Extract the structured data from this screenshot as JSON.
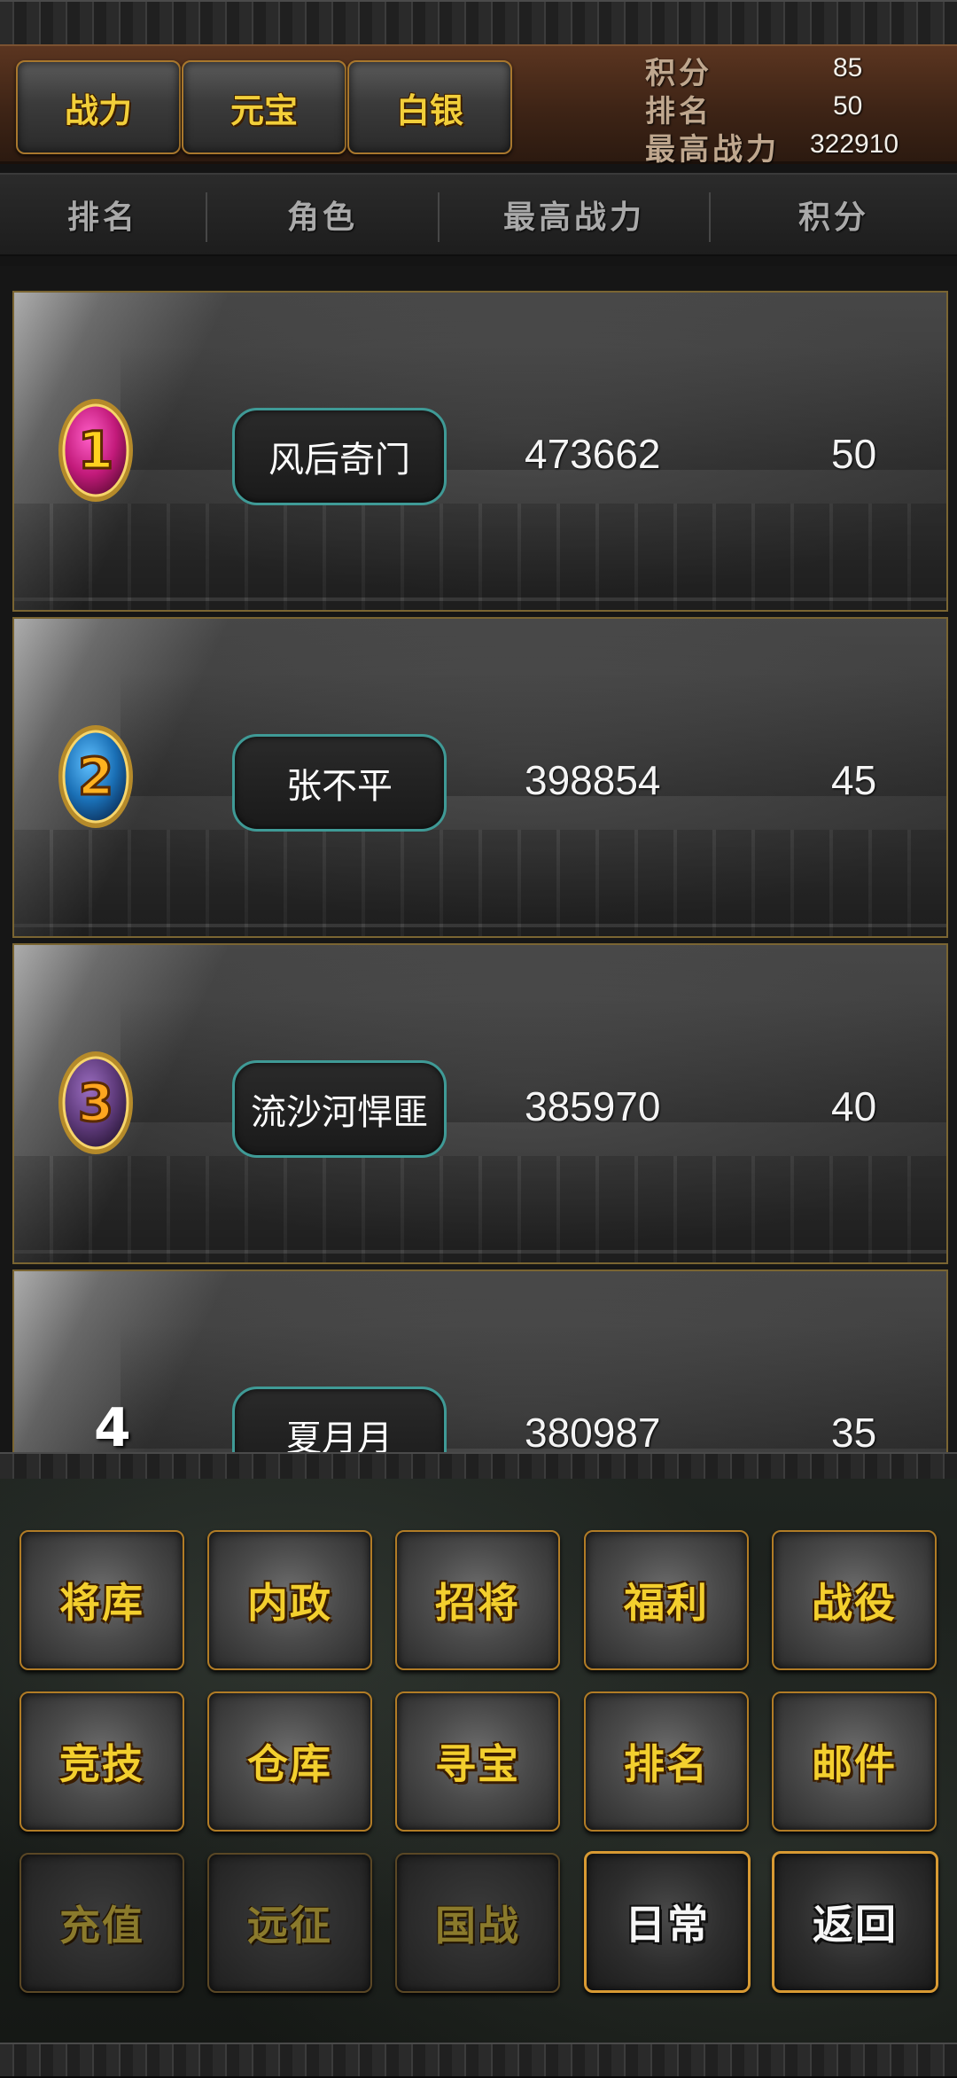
{
  "header": {
    "tabs": [
      {
        "label": "战力"
      },
      {
        "label": "元宝"
      },
      {
        "label": "白银"
      }
    ],
    "stats": {
      "score_label": "积分",
      "score_value": "85",
      "rank_label": "排名",
      "rank_value": "50",
      "maxpower_label": "最高战力",
      "maxpower_value": "322910"
    }
  },
  "columns": [
    "排名",
    "角色",
    "最高战力",
    "积分"
  ],
  "rows": [
    {
      "rank": "1",
      "name": "风后奇门",
      "power": "473662",
      "score": "50"
    },
    {
      "rank": "2",
      "name": "张不平",
      "power": "398854",
      "score": "45"
    },
    {
      "rank": "3",
      "name": "流沙河悍匪",
      "power": "385970",
      "score": "40"
    },
    {
      "rank": "4",
      "name": "夏月月",
      "power": "380987",
      "score": "35"
    }
  ],
  "menu": {
    "row1": [
      "将库",
      "内政",
      "招将",
      "福利",
      "战役"
    ],
    "row2": [
      "竞技",
      "仓库",
      "寻宝",
      "排名",
      "邮件"
    ],
    "row3": [
      "充值",
      "远征",
      "国战",
      "日常",
      "返回"
    ]
  },
  "colors": {
    "accent_gold": "#f3cf2e",
    "pill_border": "#3f9a96",
    "header_brown": "#4a2a1a"
  }
}
